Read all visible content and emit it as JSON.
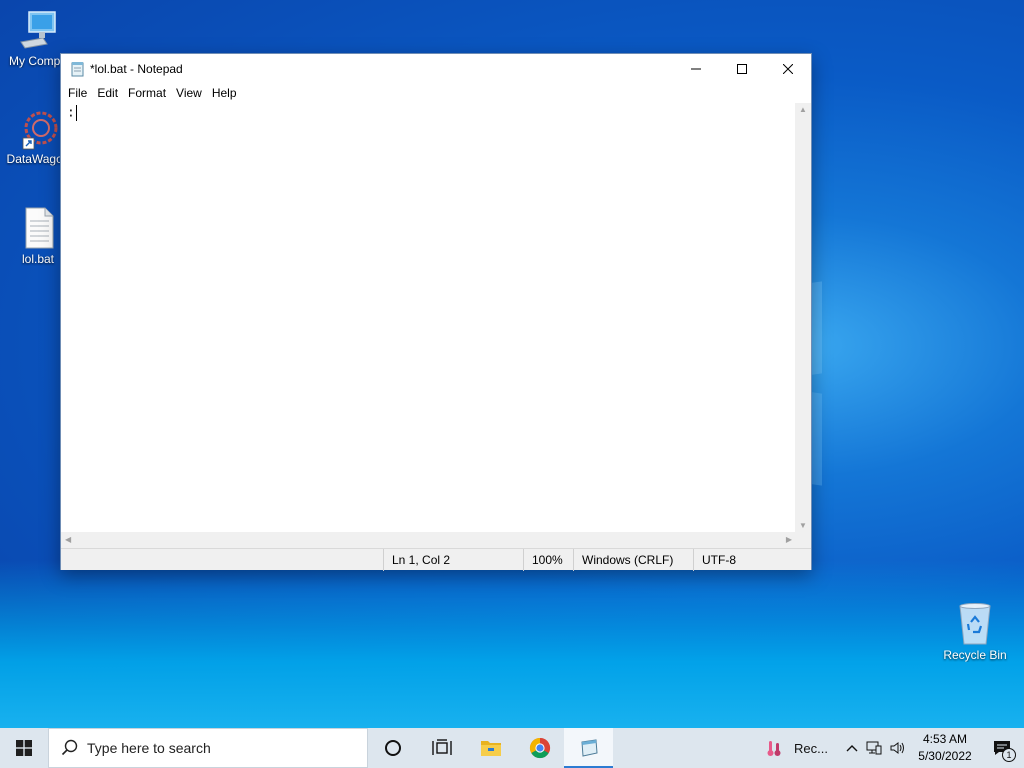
{
  "desktop": {
    "icons": [
      {
        "label": "My Compu",
        "icon": "computer-icon"
      },
      {
        "label": "DataWagon",
        "icon": "datawagon-app-icon"
      },
      {
        "label": "lol.bat",
        "icon": "text-file-icon"
      },
      {
        "label": "Recycle Bin",
        "icon": "recycle-bin-icon"
      }
    ]
  },
  "notepad": {
    "title": "*lol.bat - Notepad",
    "menu": [
      "File",
      "Edit",
      "Format",
      "View",
      "Help"
    ],
    "content": ":",
    "status": {
      "position": "Ln 1, Col 2",
      "zoom": "100%",
      "line_endings": "Windows (CRLF)",
      "encoding": "UTF-8"
    }
  },
  "taskbar": {
    "search_placeholder": "Type here to search",
    "tray_app_label": "Rec...",
    "time": "4:53 AM",
    "date": "5/30/2022",
    "notification_count": "1"
  },
  "colors": {
    "accent": "#2c7bd2",
    "taskbar": "#dde6ee"
  }
}
